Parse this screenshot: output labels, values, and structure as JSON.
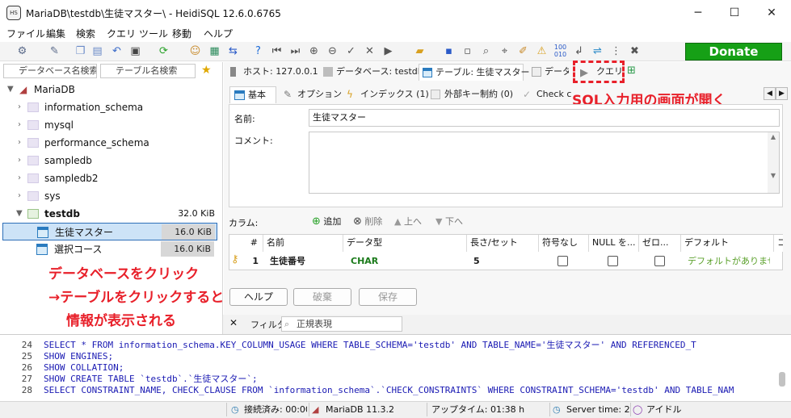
{
  "window": {
    "title": "MariaDB\\testdb\\生徒マスター\\ - HeidiSQL 12.6.0.6765",
    "icon_text": "HS",
    "minimize": "─",
    "maximize": "☐",
    "close": "✕"
  },
  "menu": [
    "ファイル",
    "編集",
    "検索",
    "クエリ",
    "ツール",
    "移動",
    "ヘルプ"
  ],
  "toolbar": {
    "donate_label": "Donate"
  },
  "left": {
    "db_filter_placeholder": "データベース名検索",
    "table_filter_placeholder": "テーブル名検索",
    "server": "MariaDB",
    "databases": [
      {
        "name": "information_schema"
      },
      {
        "name": "mysql"
      },
      {
        "name": "performance_schema"
      },
      {
        "name": "sampledb"
      },
      {
        "name": "sampledb2"
      },
      {
        "name": "sys"
      }
    ],
    "open_db": {
      "name": "testdb",
      "size": "32.0 KiB"
    },
    "tables": [
      {
        "name": "生徒マスター",
        "size": "16.0 KiB",
        "selected": true
      },
      {
        "name": "選択コース",
        "size": "16.0 KiB",
        "selected": false
      }
    ]
  },
  "annotations": {
    "left_line1": "データベースをクリック",
    "left_line2": "→テーブルをクリックすると",
    "left_line3": "情報が表示される",
    "right": "SQL入力用の画面が開く"
  },
  "tabs": [
    {
      "label": "ホスト: 127.0.0.1"
    },
    {
      "label": "データベース: testdb"
    },
    {
      "label": "テーブル: 生徒マスター"
    },
    {
      "label": "データ"
    },
    {
      "label": "クエリ"
    }
  ],
  "subtabs": [
    {
      "label": "基本"
    },
    {
      "label": "オプション"
    },
    {
      "label": "インデックス (1)"
    },
    {
      "label": "外部キー制約 (0)"
    },
    {
      "label": "Check c"
    }
  ],
  "form": {
    "name_label": "名前:",
    "name_value": "生徒マスター",
    "comment_label": "コメント:",
    "comment_value": ""
  },
  "columns_toolbar": {
    "label": "カラム:",
    "add": "追加",
    "delete": "削除",
    "up": "上へ",
    "down": "下へ"
  },
  "grid": {
    "headers": [
      "#",
      "名前",
      "データ型",
      "長さ/セット",
      "符号なし",
      "NULL を...",
      "ゼロ...",
      "デフォルト",
      "コ"
    ],
    "rows": [
      {
        "num": "1",
        "name": "生徒番号",
        "type": "CHAR",
        "length": "5",
        "default": "デフォルトがありません"
      }
    ]
  },
  "buttons": {
    "help": "ヘルプ",
    "discard": "破棄",
    "save": "保存"
  },
  "filterbar": {
    "label": "フィルタ",
    "regex": "正規表現"
  },
  "log": [
    {
      "n": "24",
      "text": "SELECT * FROM information_schema.KEY_COLUMN_USAGE WHERE   TABLE_SCHEMA='testdb'   AND TABLE_NAME='生徒マスター'   AND REFERENCED_T"
    },
    {
      "n": "25",
      "text": "SHOW ENGINES;"
    },
    {
      "n": "26",
      "text": "SHOW COLLATION;"
    },
    {
      "n": "27",
      "text": "SHOW CREATE TABLE `testdb`.`生徒マスター`;"
    },
    {
      "n": "28",
      "text": "SELECT CONSTRAINT_NAME, CHECK_CLAUSE FROM `information_schema`.`CHECK_CONSTRAINTS` WHERE CONSTRAINT_SCHEMA='testdb' AND TABLE_NAM"
    }
  ],
  "status": {
    "connected": "接続済み: 00:00",
    "server": "MariaDB 11.3.2",
    "uptime": "アップタイム: 01:38 h",
    "server_time": "Server time: 2:4",
    "idle": "アイドル"
  },
  "colors": {
    "accent_red": "#e8202a",
    "donate_green": "#16a016",
    "selection": "#cde3f7"
  }
}
